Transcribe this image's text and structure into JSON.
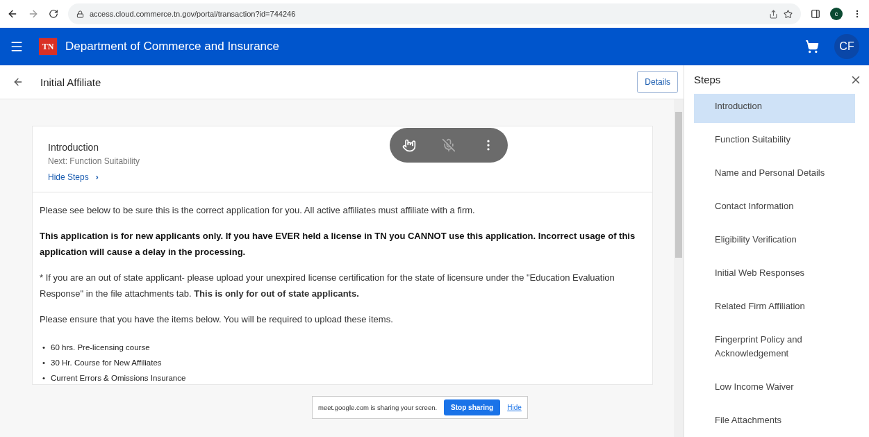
{
  "browser": {
    "url": "access.cloud.commerce.tn.gov/portal/transaction?id=744246",
    "profile_initial": "c"
  },
  "header": {
    "logo": "TN",
    "title": "Department of Commerce and Insurance",
    "avatar": "CF"
  },
  "page": {
    "title": "Initial Affiliate",
    "details_button": "Details"
  },
  "card": {
    "title": "Introduction",
    "next": "Next: Function Suitability",
    "hide_steps": "Hide Steps",
    "chevron": "›",
    "paragraphs": [
      {
        "kind": "text",
        "text": "Please see below to be sure this is the correct application for you. All active affiliates must affiliate with a firm."
      },
      {
        "kind": "bold",
        "text": "This application is for new applicants only. If you have EVER held a license in TN you CANNOT use this application. Incorrect usage of this application will cause a delay in the processing."
      },
      {
        "kind": "text",
        "text": "* If you are an out of state applicant- please upload your unexpired license certification for the state of licensure under the \"Education Evaluation Response\" in the file attachments tab. **This is only for out of state applicants.**"
      },
      {
        "kind": "text",
        "text": "Please ensure that you have the items below. You will be required to upload these items."
      }
    ],
    "bullet": "•",
    "items": [
      "60 hrs. Pre-licensing course",
      "30 Hr. Course for New Affiliates",
      "Current Errors & Omissions Insurance"
    ]
  },
  "share_bar": {
    "message": "meet.google.com is sharing your screen.",
    "stop": "Stop sharing",
    "hide": "Hide"
  },
  "steps": {
    "title": "Steps",
    "items": [
      {
        "label": "Introduction",
        "selected": true
      },
      {
        "label": "Function Suitability",
        "selected": false
      },
      {
        "label": "Name and Personal Details",
        "selected": false
      },
      {
        "label": "Contact Information",
        "selected": false
      },
      {
        "label": "Eligibility Verification",
        "selected": false
      },
      {
        "label": "Initial Web Responses",
        "selected": false
      },
      {
        "label": "Related Firm Affiliation",
        "selected": false
      },
      {
        "label": "Fingerprint Policy and Acknowledgement",
        "selected": false
      },
      {
        "label": "Low Income Waiver",
        "selected": false
      },
      {
        "label": "File Attachments",
        "selected": false
      }
    ]
  }
}
